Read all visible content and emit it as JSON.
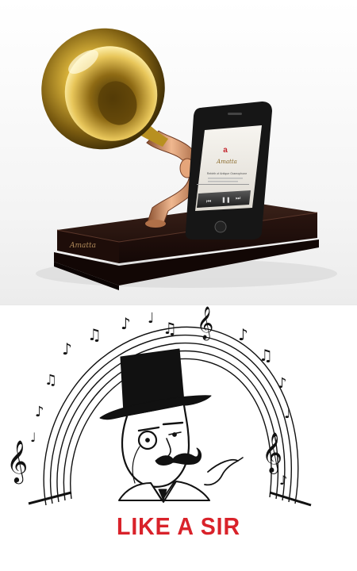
{
  "gramophone_dock": {
    "brand_script": "Amatta",
    "phone_screen": {
      "logo_text": "Amatta",
      "tagline": "Rebirth of Antique Gramophone",
      "player_controls": [
        "prev",
        "play-pause",
        "next"
      ]
    },
    "colors": {
      "horn_brass": "#c9a227",
      "neck_copper": "#c98a5e",
      "base_wood": "#2b1712"
    }
  },
  "meme": {
    "caption": "LIKE A SIR",
    "caption_color": "#d9222a",
    "icons": [
      "treble-clef-icon",
      "music-note-icon",
      "top-hat-icon",
      "monocle-icon"
    ]
  }
}
